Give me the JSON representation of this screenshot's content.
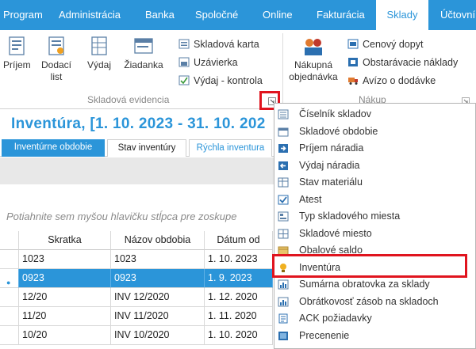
{
  "menubar": {
    "tabs": [
      "Program",
      "Administrácia",
      "Banka",
      "Spoločné",
      "Online",
      "Fakturácia",
      "Sklady",
      "Účtovní"
    ],
    "active": "Sklady"
  },
  "ribbon": {
    "skladova_evidencia": {
      "buttons": {
        "prijem": "Príjem",
        "dodaci_list_1": "Dodací",
        "dodaci_list_2": "list",
        "vydaj": "Výdaj",
        "ziadanka": "Žiadanka"
      },
      "items": [
        "Skladová karta",
        "Uzávierka",
        "Výdaj - kontrola"
      ],
      "label": "Skladová evidencia"
    },
    "nakup": {
      "buttons": {
        "nakupna_1": "Nákupná",
        "nakupna_2": "objednávka"
      },
      "items": [
        "Cenový dopyt",
        "Obstarávacie náklady",
        "Avízo o dodávke"
      ],
      "label": "Nákup"
    }
  },
  "page": {
    "title": "Inventúra,  [1. 10. 2023 - 31. 10. 202"
  },
  "tabs": [
    "Inventúrne obdobie",
    "Stav inventúry",
    "Rýchla inventura"
  ],
  "group_hint": "Potiahnite sem myšou hlavičku stĺpca pre zoskupe",
  "grid": {
    "columns": [
      "Skratka",
      "Názov obdobia",
      "Dátum od"
    ],
    "rows": [
      [
        "1023",
        "1023",
        "1. 10. 2023"
      ],
      [
        "0923",
        "0923",
        "1. 9. 2023"
      ],
      [
        "12/20",
        "INV 12/2020",
        "1. 12. 2020"
      ],
      [
        "11/20",
        "INV 11/2020",
        "1. 11. 2020"
      ],
      [
        "10/20",
        "INV 10/2020",
        "1. 10. 2020"
      ]
    ],
    "selected_index": 1
  },
  "dropdown": {
    "items": [
      {
        "label": "Číselník skladov",
        "icon": "list-icon"
      },
      {
        "label": "Skladové obdobie",
        "icon": "calendar-icon"
      },
      {
        "label": "Príjem náradia",
        "icon": "arrow-in-icon"
      },
      {
        "label": "Výdaj náradia",
        "icon": "arrow-out-icon"
      },
      {
        "label": "Stav materiálu",
        "icon": "table-icon"
      },
      {
        "label": "Atest",
        "icon": "checkbox-icon"
      },
      {
        "label": "Typ skladového miesta",
        "icon": "form-icon"
      },
      {
        "label": "Skladové miesto",
        "icon": "grid-icon"
      },
      {
        "label": "Obalové saldo",
        "icon": "box-icon"
      },
      {
        "label": "Inventúra",
        "icon": "bulb-icon"
      },
      {
        "label": "Sumárna obratovka za sklady",
        "icon": "chart-icon"
      },
      {
        "label": "Obrátkovosť zásob na skladoch",
        "icon": "chart-icon"
      },
      {
        "label": "ACK požiadavky",
        "icon": "doc-icon"
      },
      {
        "label": "Precenenie",
        "icon": "blue-square-icon"
      }
    ],
    "highlighted": "Inventúra"
  },
  "colors": {
    "accent": "#2b95d9",
    "highlight_box": "#e0141e"
  }
}
